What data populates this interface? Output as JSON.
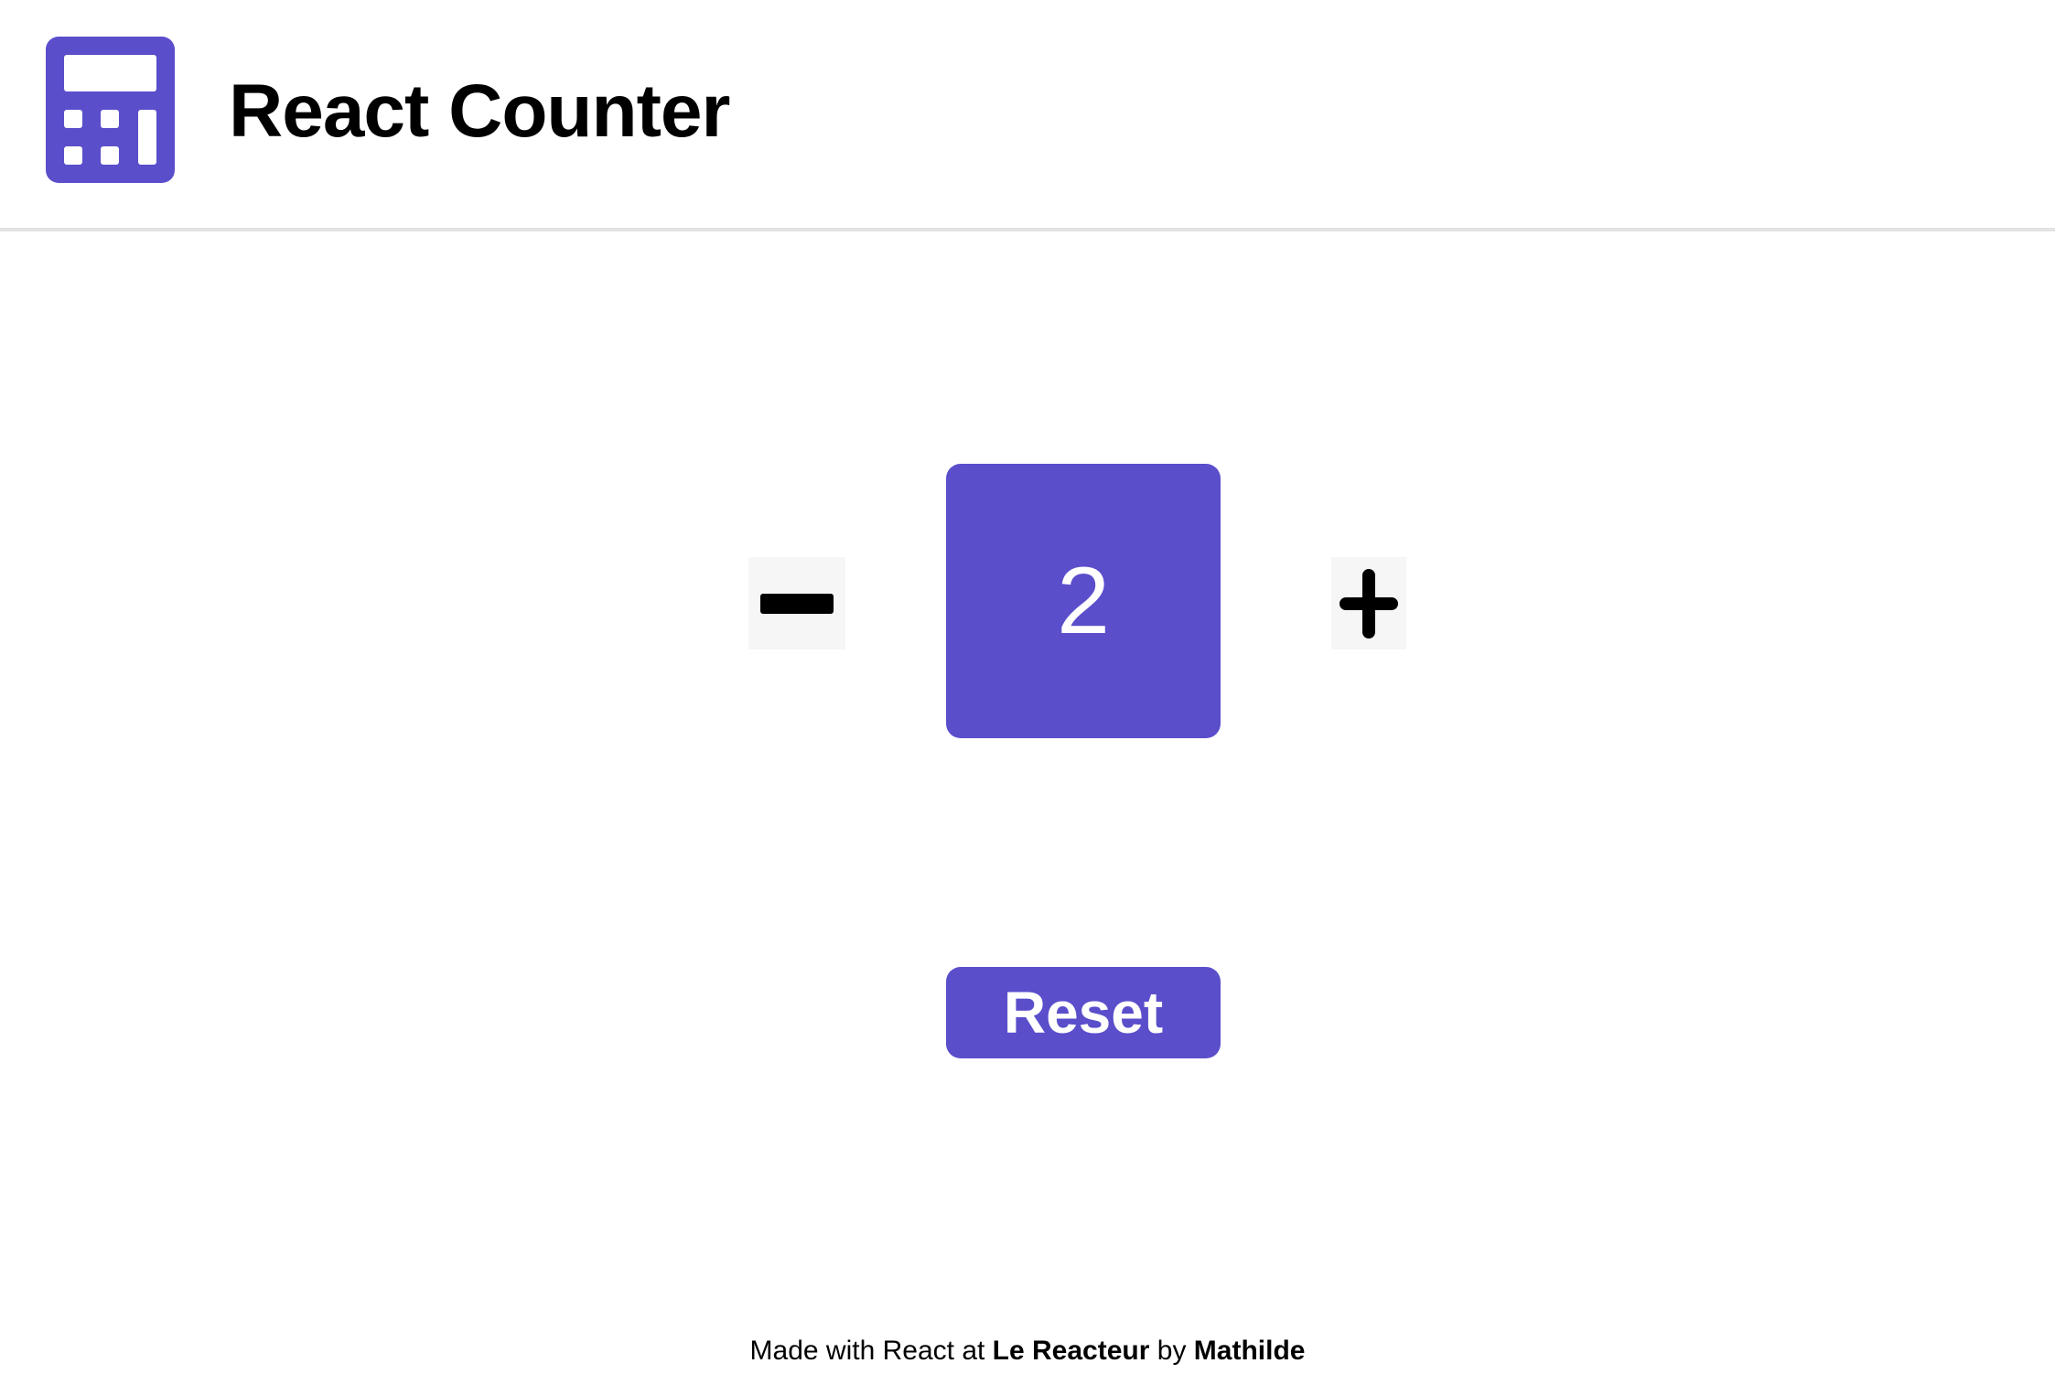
{
  "colors": {
    "accent": "#5a4ecb",
    "button_bg": "#f5f6f5",
    "divider": "#e3e3e3"
  },
  "header": {
    "logo_icon": "calculator-icon",
    "title": "React Counter"
  },
  "counter": {
    "decrement_icon": "minus-icon",
    "value": "2",
    "increment_icon": "plus-icon"
  },
  "reset": {
    "label": "Reset"
  },
  "footer": {
    "part1": "Made with React at ",
    "school": "Le Reacteur",
    "part2": " by ",
    "author": "Mathilde"
  }
}
